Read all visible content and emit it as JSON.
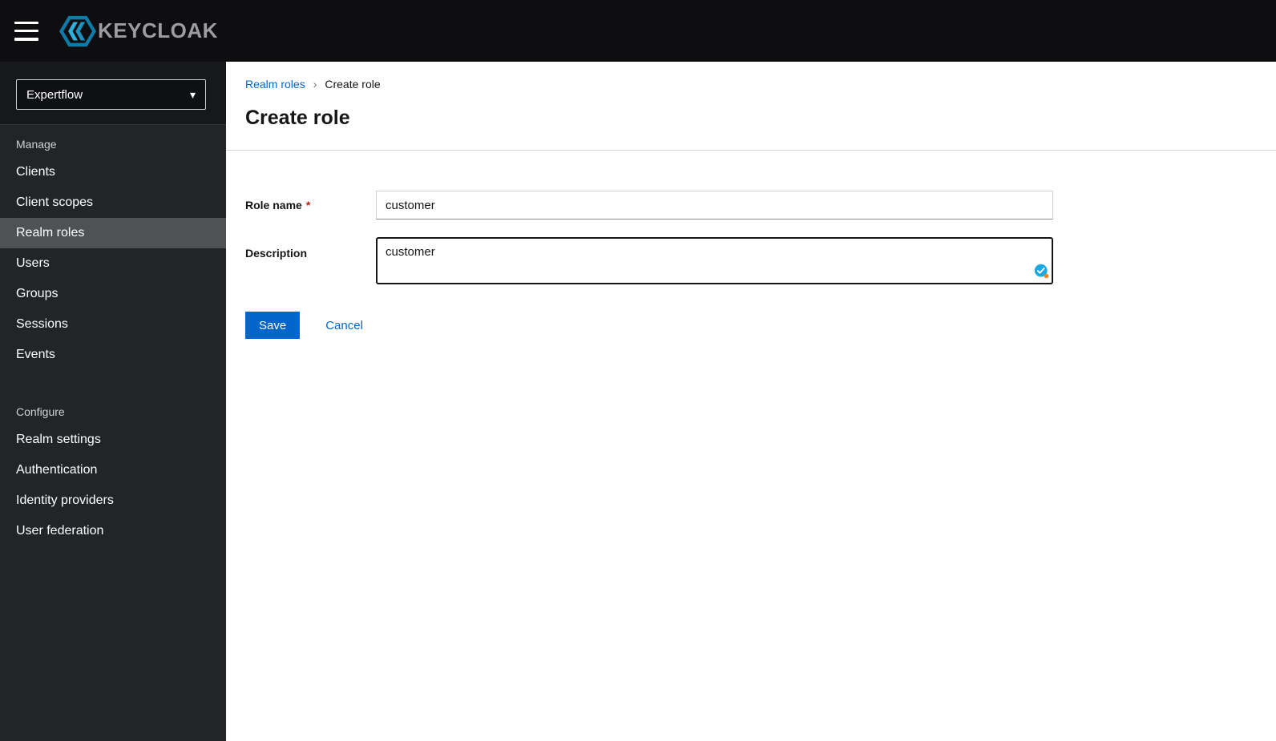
{
  "topbar": {
    "brand": "KEYCLOAK"
  },
  "icons": {
    "caret_down": "▾",
    "breadcrumb_separator": "›"
  },
  "sidebar": {
    "realm_selector": {
      "value": "Expertflow"
    },
    "sections": [
      {
        "title": "Manage",
        "items": [
          {
            "label": "Clients",
            "current": false
          },
          {
            "label": "Client scopes",
            "current": false
          },
          {
            "label": "Realm roles",
            "current": true
          },
          {
            "label": "Users",
            "current": false
          },
          {
            "label": "Groups",
            "current": false
          },
          {
            "label": "Sessions",
            "current": false
          },
          {
            "label": "Events",
            "current": false
          }
        ]
      },
      {
        "title": "Configure",
        "items": [
          {
            "label": "Realm settings",
            "current": false
          },
          {
            "label": "Authentication",
            "current": false
          },
          {
            "label": "Identity providers",
            "current": false
          },
          {
            "label": "User federation",
            "current": false
          }
        ]
      }
    ]
  },
  "breadcrumb": {
    "link": "Realm roles",
    "current": "Create role"
  },
  "page": {
    "title": "Create role"
  },
  "form": {
    "role_name": {
      "label": "Role name",
      "required": "*",
      "value": "customer"
    },
    "description": {
      "label": "Description",
      "value": "customer"
    },
    "actions": {
      "save": "Save",
      "cancel": "Cancel"
    }
  },
  "colors": {
    "accent": "#0066cc",
    "danger": "#c9190b",
    "topbar_bg": "#0e0e10",
    "sidebar_bg": "#222527",
    "nav_current_bg": "#4f5255"
  }
}
